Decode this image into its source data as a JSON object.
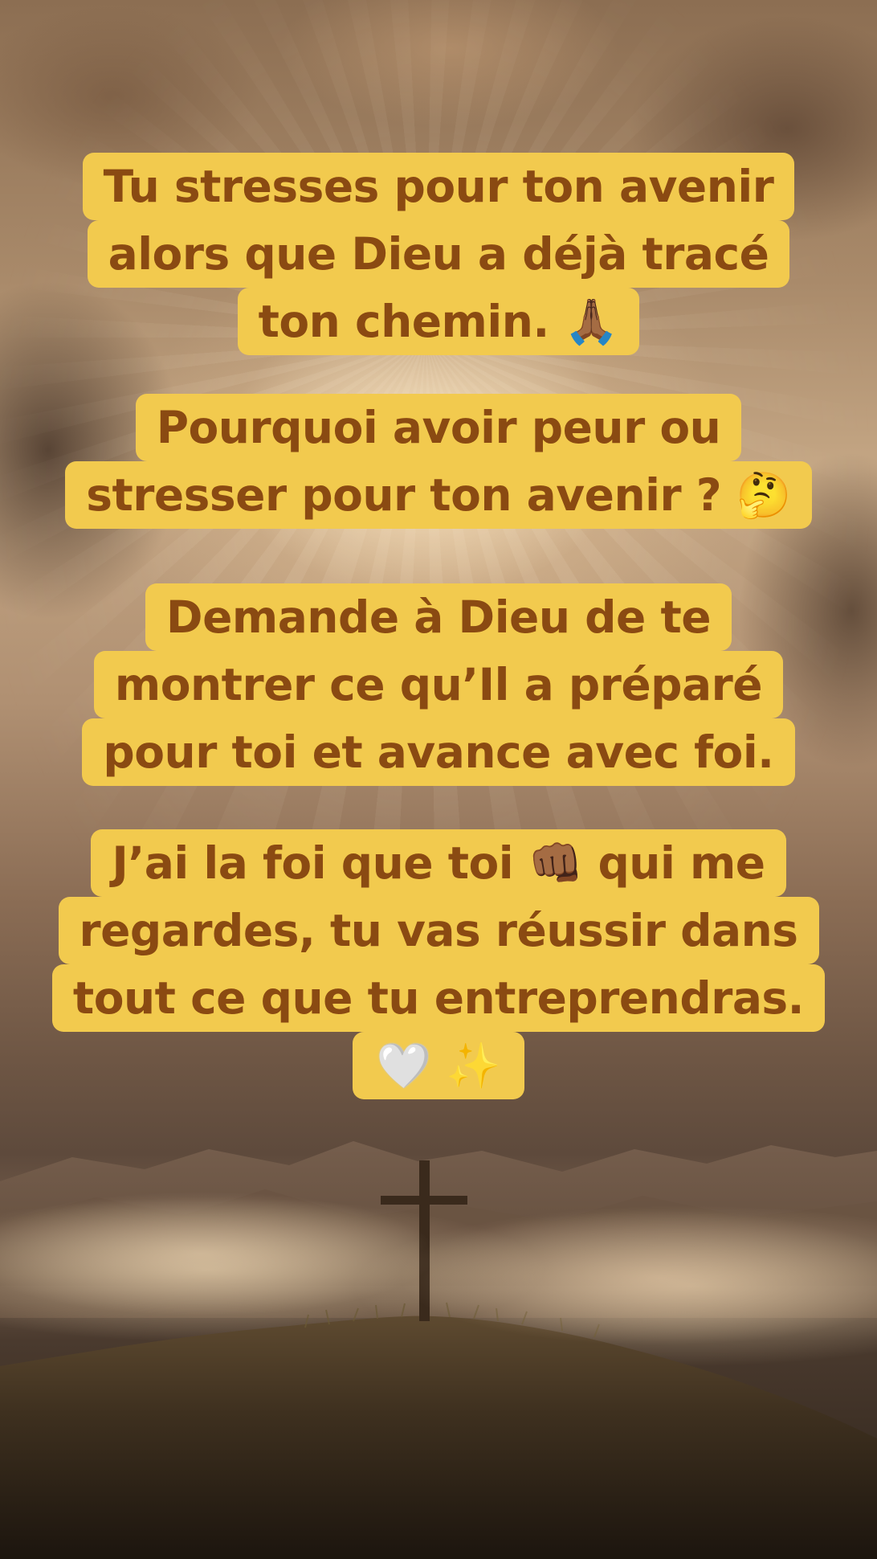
{
  "captions": {
    "block1": {
      "line1": "Tu stresses pour ton avenir",
      "line2": "alors que Dieu a déjà tracé",
      "line3_text": "ton chemin.",
      "line3_emoji": "🙏🏾"
    },
    "block2": {
      "line1": "Pourquoi avoir peur ou",
      "line2_text": "stresser pour ton avenir ?",
      "line2_emoji": "🤔"
    },
    "block3": {
      "line1": "Demande à Dieu de te",
      "line2": "montrer ce qu’Il a préparé",
      "line3": "pour toi et avance avec foi."
    },
    "block4": {
      "line1_before": "J’ai la foi que toi",
      "line1_emoji": "👊🏾",
      "line1_after": "qui me",
      "line2": "regardes, tu vas réussir dans",
      "line3": "tout ce que tu entreprendras.",
      "line4_emoji_heart": "🤍",
      "line4_emoji_sparkles": "✨"
    }
  },
  "colors": {
    "caption_background": "#f2ca4e",
    "caption_text": "#8a4a12"
  },
  "scene": {
    "description_icons": [
      "cross-icon",
      "hill",
      "clouds",
      "light-rays"
    ]
  }
}
